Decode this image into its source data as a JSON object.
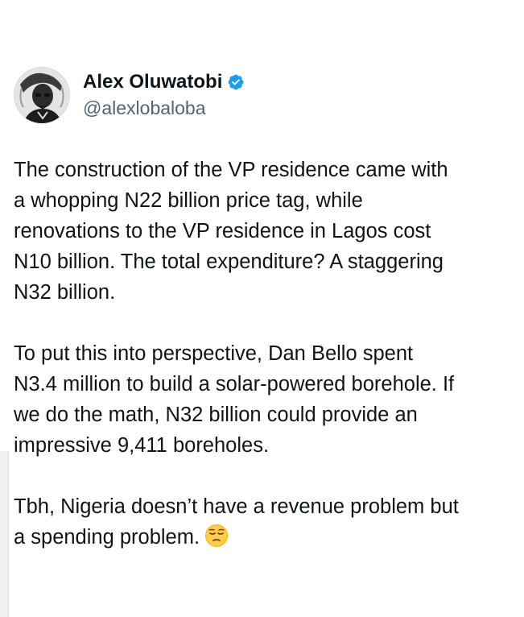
{
  "tweet": {
    "author": {
      "display_name": "Alex Oluwatobi",
      "handle": "@alexlobaloba",
      "verified": true,
      "avatar_icon": "avatar-photo",
      "verified_icon": "verified-badge-icon",
      "verified_color": "#1d9bf0"
    },
    "paragraphs": [
      "The construction of the VP residence came with\na whopping N22 billion price tag, while\nrenovations to the VP residence in Lagos cost\nN10 billion. The total expenditure? A staggering\nN32 billion.",
      "To put this into perspective, Dan Bello spent\nN3.4 million to build a solar-powered borehole. If\nwe do the math, N32 billion could provide an\nimpressive 9,411 boreholes.",
      "Tbh, Nigeria doesn’t have a revenue problem but\na spending problem."
    ],
    "trailing_emoji": "pensive-face-emoji"
  }
}
